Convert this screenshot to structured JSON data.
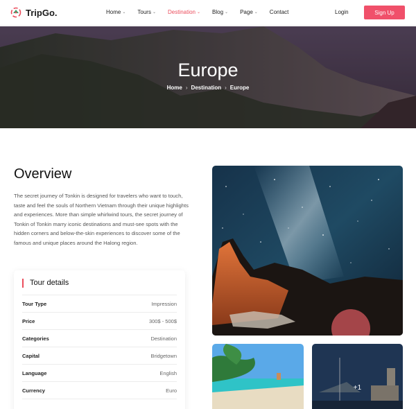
{
  "brand": {
    "name": "TripGo.",
    "accent": "#eb4d5c"
  },
  "nav": {
    "items": [
      {
        "label": "Home",
        "has_dropdown": true
      },
      {
        "label": "Tours",
        "has_dropdown": true
      },
      {
        "label": "Destination",
        "has_dropdown": true,
        "active": true
      },
      {
        "label": "Blog",
        "has_dropdown": true
      },
      {
        "label": "Page",
        "has_dropdown": true
      },
      {
        "label": "Contact",
        "has_dropdown": false
      }
    ],
    "login_label": "Login",
    "signup_label": "Sign Up"
  },
  "hero": {
    "title": "Europe",
    "breadcrumb": [
      "Home",
      "Destination",
      "Europe"
    ]
  },
  "overview": {
    "title": "Overview",
    "text": "The secret journey of Tonkin is designed for travelers who want to touch, taste and feel the souls of Northern Vietnam through their unique highlights and experiences. More than simple whirlwind tours, the secret journey of Tonkin of Tonkin marry iconic destinations and must-see spots with the hidden corners and below-the-skin experiences to discover some of the famous and unique places around the Halong region."
  },
  "tour_details": {
    "title": "Tour details",
    "rows": [
      {
        "label": "Tour Type",
        "value": "Impression"
      },
      {
        "label": "Price",
        "value": "300$ - 500$"
      },
      {
        "label": "Categories",
        "value": "Destination"
      },
      {
        "label": "Capital",
        "value": "Bridgetown"
      },
      {
        "label": "Language",
        "value": "English"
      },
      {
        "label": "Currency",
        "value": "Euro"
      }
    ]
  },
  "gallery": {
    "more_label": "+1"
  }
}
